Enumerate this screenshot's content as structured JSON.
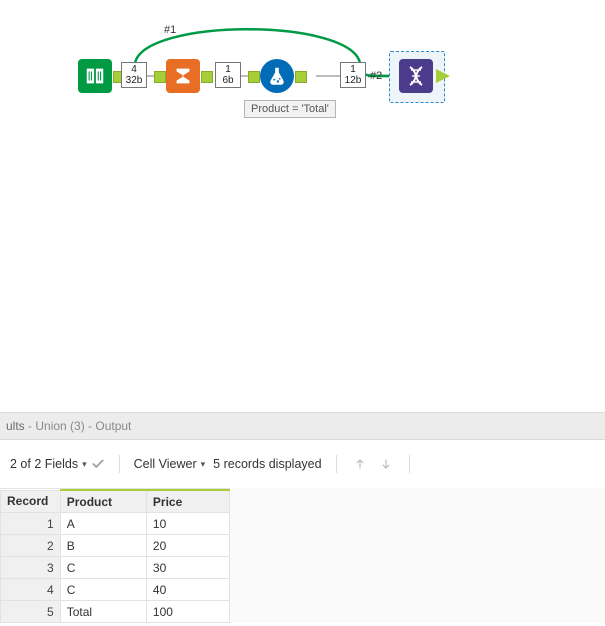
{
  "canvas": {
    "hash1": "#1",
    "hash2": "#2",
    "tags": {
      "t1": {
        "num": "4",
        "bytes": "32b"
      },
      "t2": {
        "num": "1",
        "bytes": "6b"
      },
      "t3": {
        "num": "1",
        "bytes": "12b"
      }
    },
    "annotation": "Product = 'Total'",
    "tools": {
      "input": {
        "name": "Text Input",
        "color": "#009a44"
      },
      "summarize": {
        "name": "Summarize",
        "color": "#e86e25"
      },
      "formula": {
        "name": "Formula",
        "color": "#006bb6"
      },
      "union": {
        "name": "Union",
        "color": "#4b3c8c"
      }
    }
  },
  "results": {
    "title_prefix": "ults",
    "title_suffix": " - Union (3) - Output",
    "fields_label": "2 of 2 Fields",
    "cell_viewer_label": "Cell Viewer",
    "records_label": "5 records displayed",
    "columns": [
      "Record",
      "Product",
      "Price"
    ],
    "rows": [
      {
        "rec": "1",
        "product": "A",
        "price": "10"
      },
      {
        "rec": "2",
        "product": "B",
        "price": "20"
      },
      {
        "rec": "3",
        "product": "C",
        "price": "30"
      },
      {
        "rec": "4",
        "product": "C",
        "price": "40"
      },
      {
        "rec": "5",
        "product": "Total",
        "price": "100"
      }
    ]
  },
  "chart_data": {
    "type": "table",
    "title": "Union (3) - Output",
    "columns": [
      "Record",
      "Product",
      "Price"
    ],
    "rows": [
      [
        1,
        "A",
        10
      ],
      [
        2,
        "B",
        20
      ],
      [
        3,
        "C",
        30
      ],
      [
        4,
        "C",
        40
      ],
      [
        5,
        "Total",
        100
      ]
    ]
  }
}
